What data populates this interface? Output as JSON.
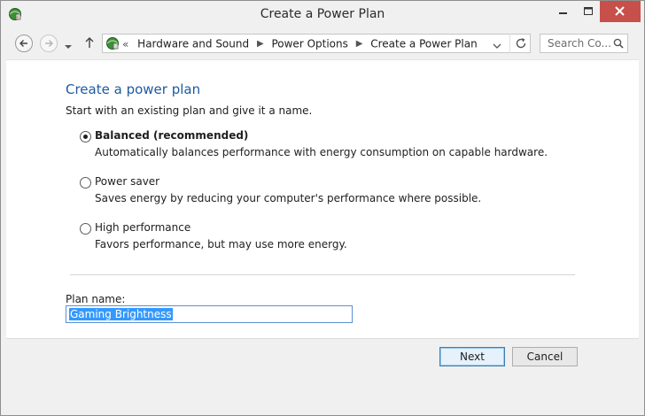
{
  "window": {
    "title": "Create a Power Plan",
    "controls": [
      "minimize",
      "maximize",
      "close"
    ]
  },
  "navigation": {
    "breadcrumb_overflow": "«",
    "breadcrumbs": [
      "Hardware and Sound",
      "Power Options",
      "Create a Power Plan"
    ],
    "search_placeholder": "Search Co..."
  },
  "page": {
    "heading": "Create a power plan",
    "subtitle": "Start with an existing plan and give it a name.",
    "options": [
      {
        "label": "Balanced (recommended)",
        "description": "Automatically balances performance with energy consumption on capable hardware.",
        "selected": true
      },
      {
        "label": "Power saver",
        "description": "Saves energy by reducing your computer's performance where possible.",
        "selected": false
      },
      {
        "label": "High performance",
        "description": "Favors performance, but may use more energy.",
        "selected": false
      }
    ],
    "plan_name_label": "Plan name:",
    "plan_name_value": "Gaming Brightness"
  },
  "buttons": {
    "next": "Next",
    "cancel": "Cancel"
  },
  "colors": {
    "heading": "#1e5aa0",
    "close_button": "#c7504b",
    "selection": "#3399ff"
  },
  "icons": {
    "app": "power-options-icon",
    "back": "back-arrow-icon",
    "forward": "forward-arrow-icon",
    "up": "up-arrow-icon",
    "refresh": "refresh-icon",
    "search": "search-icon"
  }
}
